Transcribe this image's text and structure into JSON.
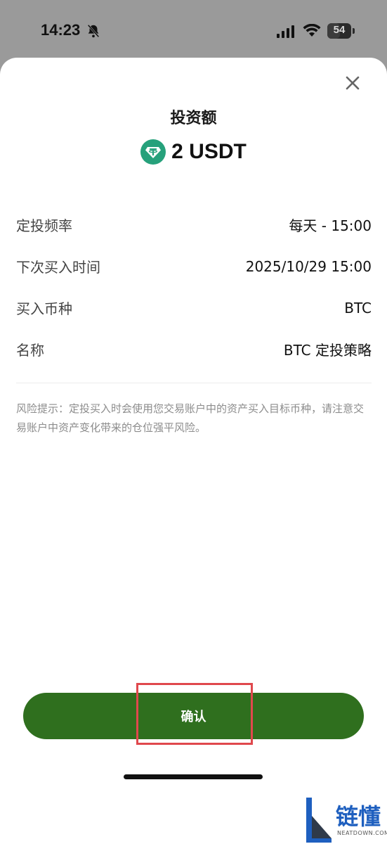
{
  "status_bar": {
    "time": "14:23",
    "battery_level": "54",
    "battery_fraction": 0.54
  },
  "sheet": {
    "title": "投资额",
    "amount": "2 USDT",
    "currency_icon": "usdt-tether-icon",
    "rows": [
      {
        "label": "定投频率",
        "value": "每天 - 15:00"
      },
      {
        "label": "下次买入时间",
        "value": "2025/10/29 15:00"
      },
      {
        "label": "买入币种",
        "value": "BTC"
      },
      {
        "label": "名称",
        "value": "BTC 定投策略"
      }
    ],
    "risk_note": "风险提示：定投买入时会使用您交易账户中的资产买入目标币种，请注意交易账户中资产变化带来的仓位强平风险。",
    "confirm_label": "确认"
  },
  "watermark": {
    "text": "链懂",
    "sub": "NEATDOWN.COM"
  },
  "colors": {
    "accent": "#2f6f1e",
    "usdt": "#26a17b",
    "highlight": "#e0484d"
  }
}
